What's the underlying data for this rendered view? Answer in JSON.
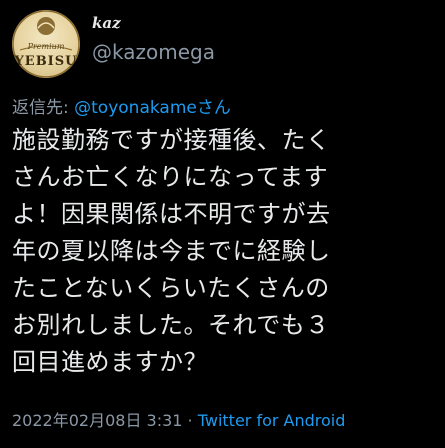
{
  "author": {
    "display_name": "kaz",
    "handle": "@kazomega",
    "avatar_logo_text": "YEBISU",
    "avatar_logo_sub": "Premium"
  },
  "reply": {
    "prefix": "返信先: ",
    "mention": "@toyonakameさん"
  },
  "body": {
    "lines": [
      "施設勤務ですが接種後、たく",
      "さんお亡くなりになってます",
      "よ！因果関係は不明ですが去",
      "年の夏以降は今までに経験し",
      "たことないくらいたくさんの",
      "お別れしました。それでも３",
      "回目進めますか？"
    ]
  },
  "meta": {
    "timestamp": "2022年02月08日 3:31",
    "separator": " · ",
    "source": "Twitter for Android"
  },
  "colors": {
    "background": "#000000",
    "text": "#e7e9ea",
    "secondary": "#8b98a5",
    "link": "#1d9bf0"
  }
}
